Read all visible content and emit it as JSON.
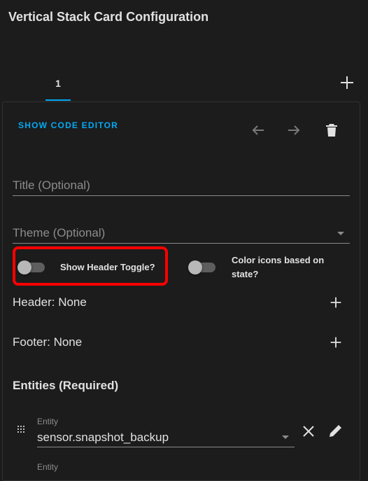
{
  "dialog": {
    "title": "Vertical Stack Card Configuration"
  },
  "tabs": [
    {
      "label": "1",
      "selected": true
    }
  ],
  "toolbar": {
    "code_editor_label": "SHOW CODE EDITOR"
  },
  "icons": {
    "add_card": "plus-icon",
    "move_left": "arrow-left-icon",
    "move_right": "arrow-right-icon",
    "delete": "trash-icon",
    "add_header": "plus-icon",
    "add_footer": "plus-icon",
    "drag": "drag-handle-icon",
    "clear": "close-icon",
    "edit": "pencil-icon"
  },
  "form": {
    "title_label": "Title (Optional)",
    "theme_label": "Theme (Optional)",
    "show_header_toggle_label": "Show Header Toggle?",
    "show_header_toggle_on": false,
    "state_color_label_line1": "Color icons based on",
    "state_color_label_line2": "state?",
    "state_color_on": false,
    "header_label": "Header: None",
    "footer_label": "Footer: None",
    "entities_title": "Entities (Required)",
    "entity_label": "Entity",
    "entity_value": "sensor.snapshot_backup",
    "entity2_label": "Entity"
  },
  "colors": {
    "accent": "#03a9f4",
    "highlight": "#ff0000",
    "background": "#1c1c1c"
  }
}
